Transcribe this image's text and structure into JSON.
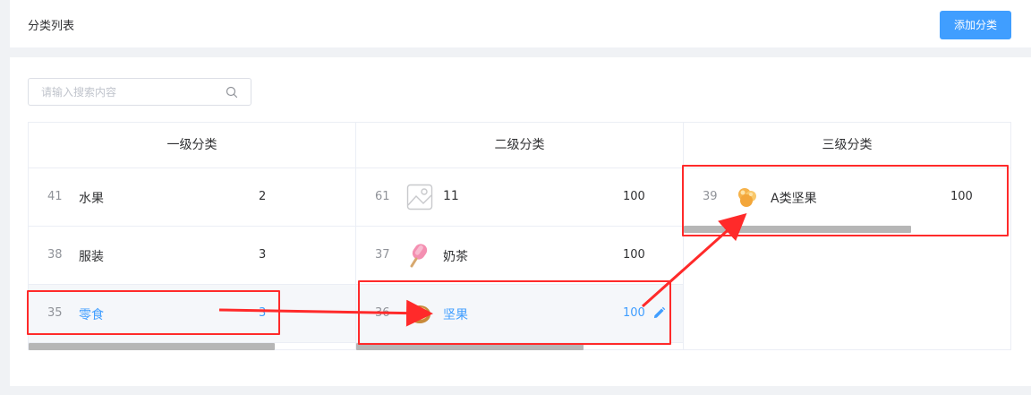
{
  "header": {
    "title": "分类列表",
    "add_button_label": "添加分类"
  },
  "search": {
    "placeholder": "请输入搜索内容",
    "value": ""
  },
  "columns": [
    {
      "title": "一级分类",
      "items": [
        {
          "id": "41",
          "name": "水果",
          "count": "2"
        },
        {
          "id": "38",
          "name": "服装",
          "count": "3"
        },
        {
          "id": "35",
          "name": "零食",
          "count": "3",
          "active": true
        }
      ]
    },
    {
      "title": "二级分类",
      "items": [
        {
          "id": "61",
          "name": "11",
          "count": "100",
          "icon": "image-placeholder-icon"
        },
        {
          "id": "37",
          "name": "奶茶",
          "count": "100",
          "icon": "popsicle-icon"
        },
        {
          "id": "36",
          "name": "坚果",
          "count": "100",
          "icon": "nut-icon",
          "active": true
        }
      ]
    },
    {
      "title": "三级分类",
      "items": [
        {
          "id": "39",
          "name": "A类坚果",
          "count": "100",
          "icon": "popcorn-icon"
        }
      ]
    }
  ],
  "colors": {
    "accent": "#409eff",
    "annotation": "#ff2a2a",
    "text": "#303133",
    "muted": "#909399"
  }
}
